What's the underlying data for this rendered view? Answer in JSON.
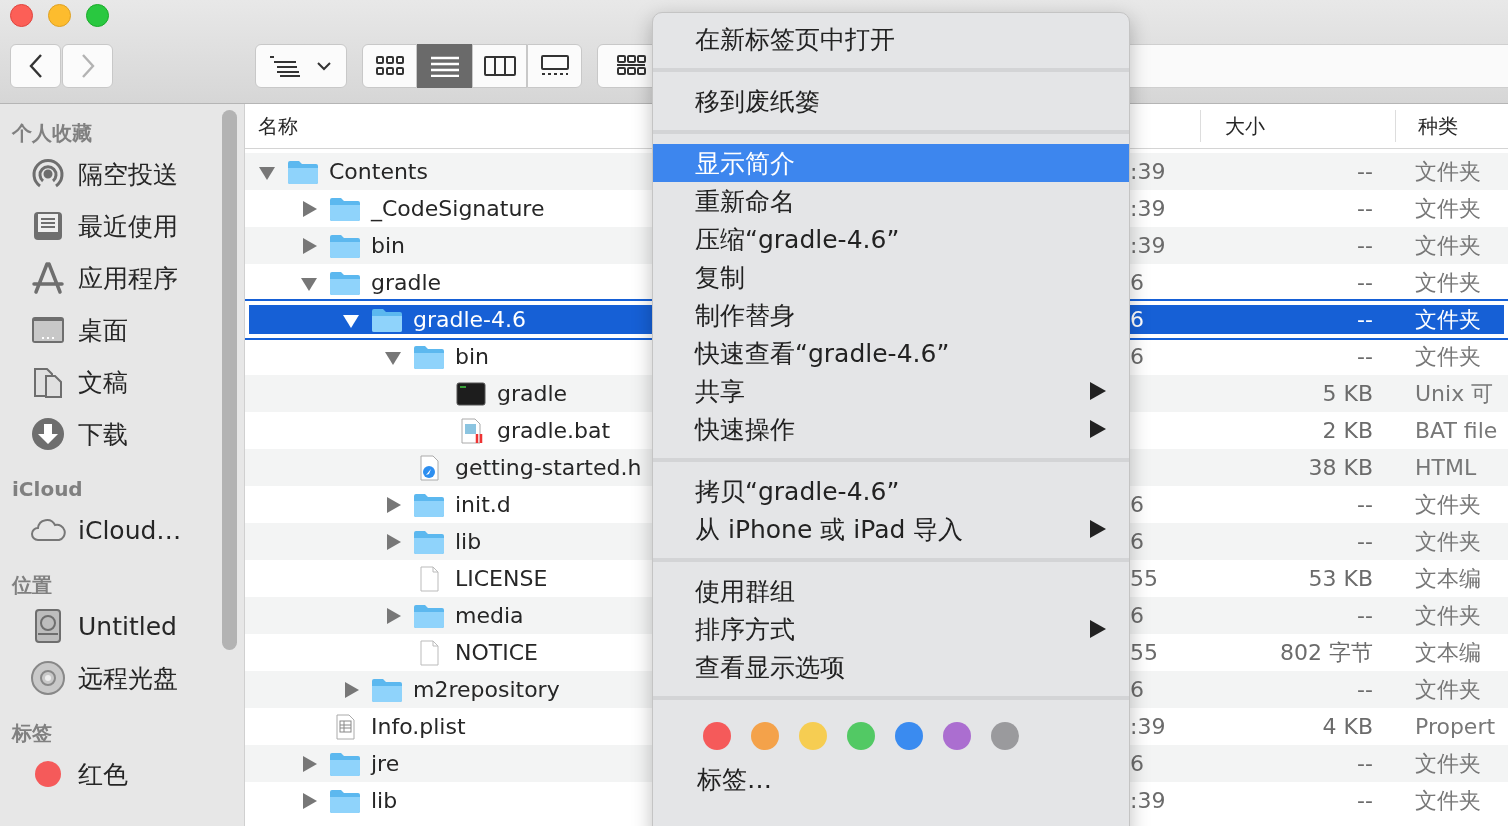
{
  "toolbar": {
    "nav": [
      {
        "kind": "back",
        "disabled": false
      },
      {
        "kind": "forward",
        "disabled": true
      }
    ],
    "views": [
      {
        "kind": "icons",
        "selected": false
      },
      {
        "kind": "list",
        "selected": true
      },
      {
        "kind": "columns",
        "selected": false
      },
      {
        "kind": "gallery",
        "selected": false
      }
    ]
  },
  "sidebar": {
    "sections": [
      {
        "title": "个人收藏",
        "items": [
          {
            "label": "隔空投送",
            "kind": "airdrop"
          },
          {
            "label": "最近使用",
            "kind": "recent"
          },
          {
            "label": "应用程序",
            "kind": "apps"
          },
          {
            "label": "桌面",
            "kind": "desktop"
          },
          {
            "label": "文稿",
            "kind": "docs"
          },
          {
            "label": "下载",
            "kind": "download"
          }
        ]
      },
      {
        "title": "iCloud",
        "items": [
          {
            "label": "iCloud…",
            "kind": "cloud"
          }
        ]
      },
      {
        "title": "位置",
        "items": [
          {
            "label": "Untitled",
            "kind": "disk"
          },
          {
            "label": "远程光盘",
            "kind": "cd"
          }
        ]
      },
      {
        "title": "标签",
        "items": [
          {
            "label": "红色",
            "kind": "tag",
            "color": "#f55a5a"
          }
        ]
      }
    ]
  },
  "table": {
    "columns": [
      {
        "label": "名称"
      },
      {
        "label": "大小"
      },
      {
        "label": "种类"
      }
    ],
    "rows": [
      {
        "name": "Contents",
        "kind": "folder",
        "expanded": true,
        "selected": false,
        "date": ":39",
        "size": "--",
        "type_label": "文件夹",
        "children": [
          {
            "name": "_CodeSignature",
            "kind": "folder",
            "expanded": false,
            "selected": false,
            "date": ":39",
            "size": "--",
            "type_label": "文件夹"
          },
          {
            "name": "bin",
            "kind": "folder",
            "expanded": false,
            "selected": false,
            "date": ":39",
            "size": "--",
            "type_label": "文件夹"
          },
          {
            "name": "gradle",
            "kind": "folder",
            "expanded": true,
            "selected": false,
            "date": "6",
            "size": "--",
            "type_label": "文件夹",
            "children": [
              {
                "name": "gradle-4.6",
                "kind": "folder",
                "expanded": true,
                "selected": true,
                "date": "6",
                "size": "--",
                "type_label": "文件夹",
                "children": [
                  {
                    "name": "bin",
                    "kind": "folder",
                    "expanded": true,
                    "selected": false,
                    "date": "6",
                    "size": "--",
                    "type_label": "文件夹",
                    "children": [
                      {
                        "name": "gradle",
                        "kind": "exec",
                        "selected": false,
                        "size": "5 KB",
                        "type_label": "Unix 可"
                      },
                      {
                        "name": "gradle.bat",
                        "kind": "bat",
                        "selected": false,
                        "size": "2 KB",
                        "type_label": "BAT file"
                      }
                    ]
                  },
                  {
                    "name": "getting-started.h",
                    "kind": "html",
                    "selected": false,
                    "size": "38 KB",
                    "type_label": "HTML"
                  },
                  {
                    "name": "init.d",
                    "kind": "folder",
                    "expanded": false,
                    "selected": false,
                    "date": "6",
                    "size": "--",
                    "type_label": "文件夹"
                  },
                  {
                    "name": "lib",
                    "kind": "folder",
                    "expanded": false,
                    "selected": false,
                    "date": "6",
                    "size": "--",
                    "type_label": "文件夹"
                  },
                  {
                    "name": "LICENSE",
                    "kind": "doc",
                    "selected": false,
                    "date": "55",
                    "size": "53 KB",
                    "type_label": "文本编"
                  },
                  {
                    "name": "media",
                    "kind": "folder",
                    "expanded": false,
                    "selected": false,
                    "date": "6",
                    "size": "--",
                    "type_label": "文件夹"
                  },
                  {
                    "name": "NOTICE",
                    "kind": "doc",
                    "selected": false,
                    "date": "55",
                    "size": "802 字节",
                    "type_label": "文本编"
                  }
                ]
              },
              {
                "name": "m2repository",
                "kind": "folder",
                "expanded": false,
                "selected": false,
                "date": "6",
                "size": "--",
                "type_label": "文件夹"
              }
            ]
          },
          {
            "name": "Info.plist",
            "kind": "plist",
            "selected": false,
            "date": ":39",
            "size": "4 KB",
            "type_label": "Propert"
          },
          {
            "name": "jre",
            "kind": "folder",
            "expanded": false,
            "selected": false,
            "date": "6",
            "size": "--",
            "type_label": "文件夹"
          },
          {
            "name": "lib",
            "kind": "folder",
            "expanded": false,
            "selected": false,
            "date": ":39",
            "size": "--",
            "type_label": "文件夹"
          }
        ]
      }
    ]
  },
  "context_menu": {
    "sections": [
      {
        "items": [
          {
            "kind": "item",
            "label": "在新标签页中打开",
            "selected": false,
            "submenu": false
          }
        ]
      },
      {
        "items": [
          {
            "kind": "item",
            "label": "移到废纸篓",
            "selected": false,
            "submenu": false
          }
        ]
      },
      {
        "items": [
          {
            "kind": "item",
            "label": "显示简介",
            "selected": true,
            "submenu": false
          },
          {
            "kind": "item",
            "label": "重新命名",
            "selected": false,
            "submenu": false
          },
          {
            "kind": "item",
            "label": "压缩“gradle-4.6”",
            "selected": false,
            "submenu": false
          },
          {
            "kind": "item",
            "label": "复制",
            "selected": false,
            "submenu": false
          },
          {
            "kind": "item",
            "label": "制作替身",
            "selected": false,
            "submenu": false
          },
          {
            "kind": "item",
            "label": "快速查看“gradle-4.6”",
            "selected": false,
            "submenu": false
          },
          {
            "kind": "item",
            "label": "共享",
            "selected": false,
            "submenu": true
          },
          {
            "kind": "item",
            "label": "快速操作",
            "selected": false,
            "submenu": true
          }
        ]
      },
      {
        "items": [
          {
            "kind": "item",
            "label": "拷贝“gradle-4.6”",
            "selected": false,
            "submenu": false
          },
          {
            "kind": "item",
            "label": "从 iPhone 或 iPad 导入",
            "selected": false,
            "submenu": true
          }
        ]
      },
      {
        "items": [
          {
            "kind": "item",
            "label": "使用群组",
            "selected": false,
            "submenu": false
          },
          {
            "kind": "item",
            "label": "排序方式",
            "selected": false,
            "submenu": true
          },
          {
            "kind": "item",
            "label": "查看显示选项",
            "selected": false,
            "submenu": false
          }
        ]
      },
      {
        "items": [
          {
            "kind": "colors",
            "colors": [
              {
                "color": "#f55a5a"
              },
              {
                "color": "#f4a24a"
              },
              {
                "color": "#f6cd52"
              },
              {
                "color": "#52c964"
              },
              {
                "color": "#3a8bf0"
              },
              {
                "color": "#ab6ed0"
              },
              {
                "color": "#9a9a9d"
              }
            ]
          },
          {
            "kind": "item",
            "label": "标签…",
            "selected": false,
            "submenu": false
          }
        ]
      }
    ]
  }
}
